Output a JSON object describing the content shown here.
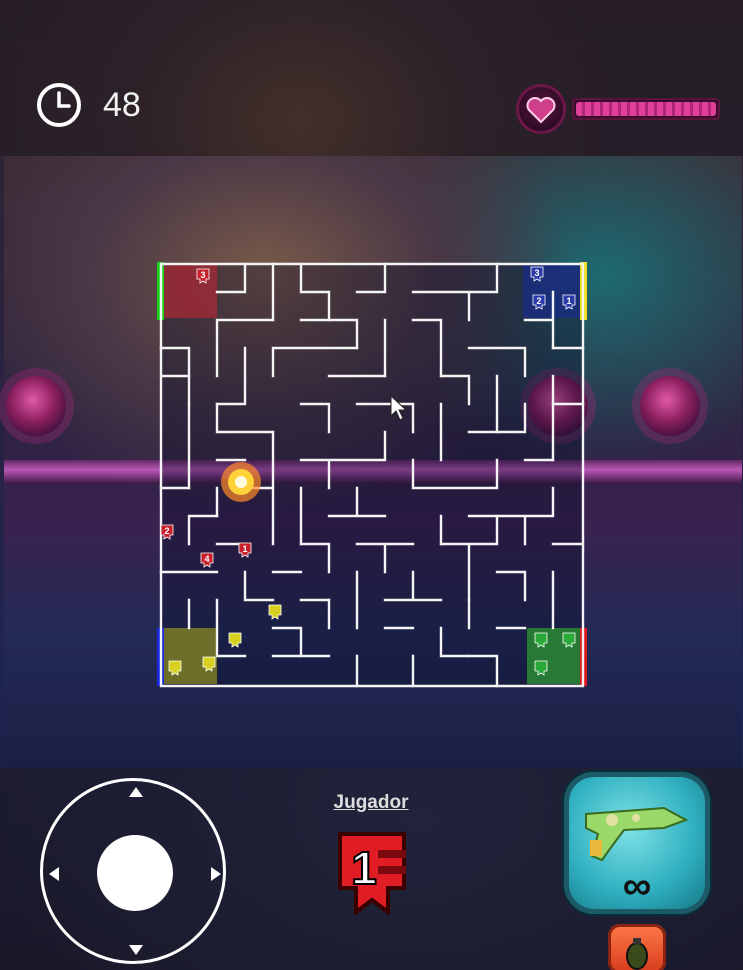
{
  "hud": {
    "timer_icon": "clock-icon",
    "timer_value": "48",
    "health_icon": "heart-icon",
    "health_level": 1.0
  },
  "game": {
    "cursor_icon": "mouse-pointer-icon",
    "explosion_icon": "explosion-icon",
    "teams": [
      {
        "name": "red",
        "color": "#c8202a",
        "units": [
          "3",
          "2",
          "4",
          "1"
        ]
      },
      {
        "name": "blue",
        "color": "#2a3aa8",
        "units": [
          "3",
          "2",
          "1"
        ]
      },
      {
        "name": "yellow",
        "color": "#d8d020",
        "units": [
          "",
          "",
          "",
          ""
        ]
      },
      {
        "name": "green",
        "color": "#2aa838",
        "units": [
          "",
          "",
          ""
        ]
      }
    ]
  },
  "controls": {
    "joystick_icon": "joystick-icon",
    "player_label": "Jugador",
    "player_number": "1",
    "weapon_icon": "ray-gun-icon",
    "ammo": "∞",
    "grenade_icon": "grenade-icon"
  }
}
